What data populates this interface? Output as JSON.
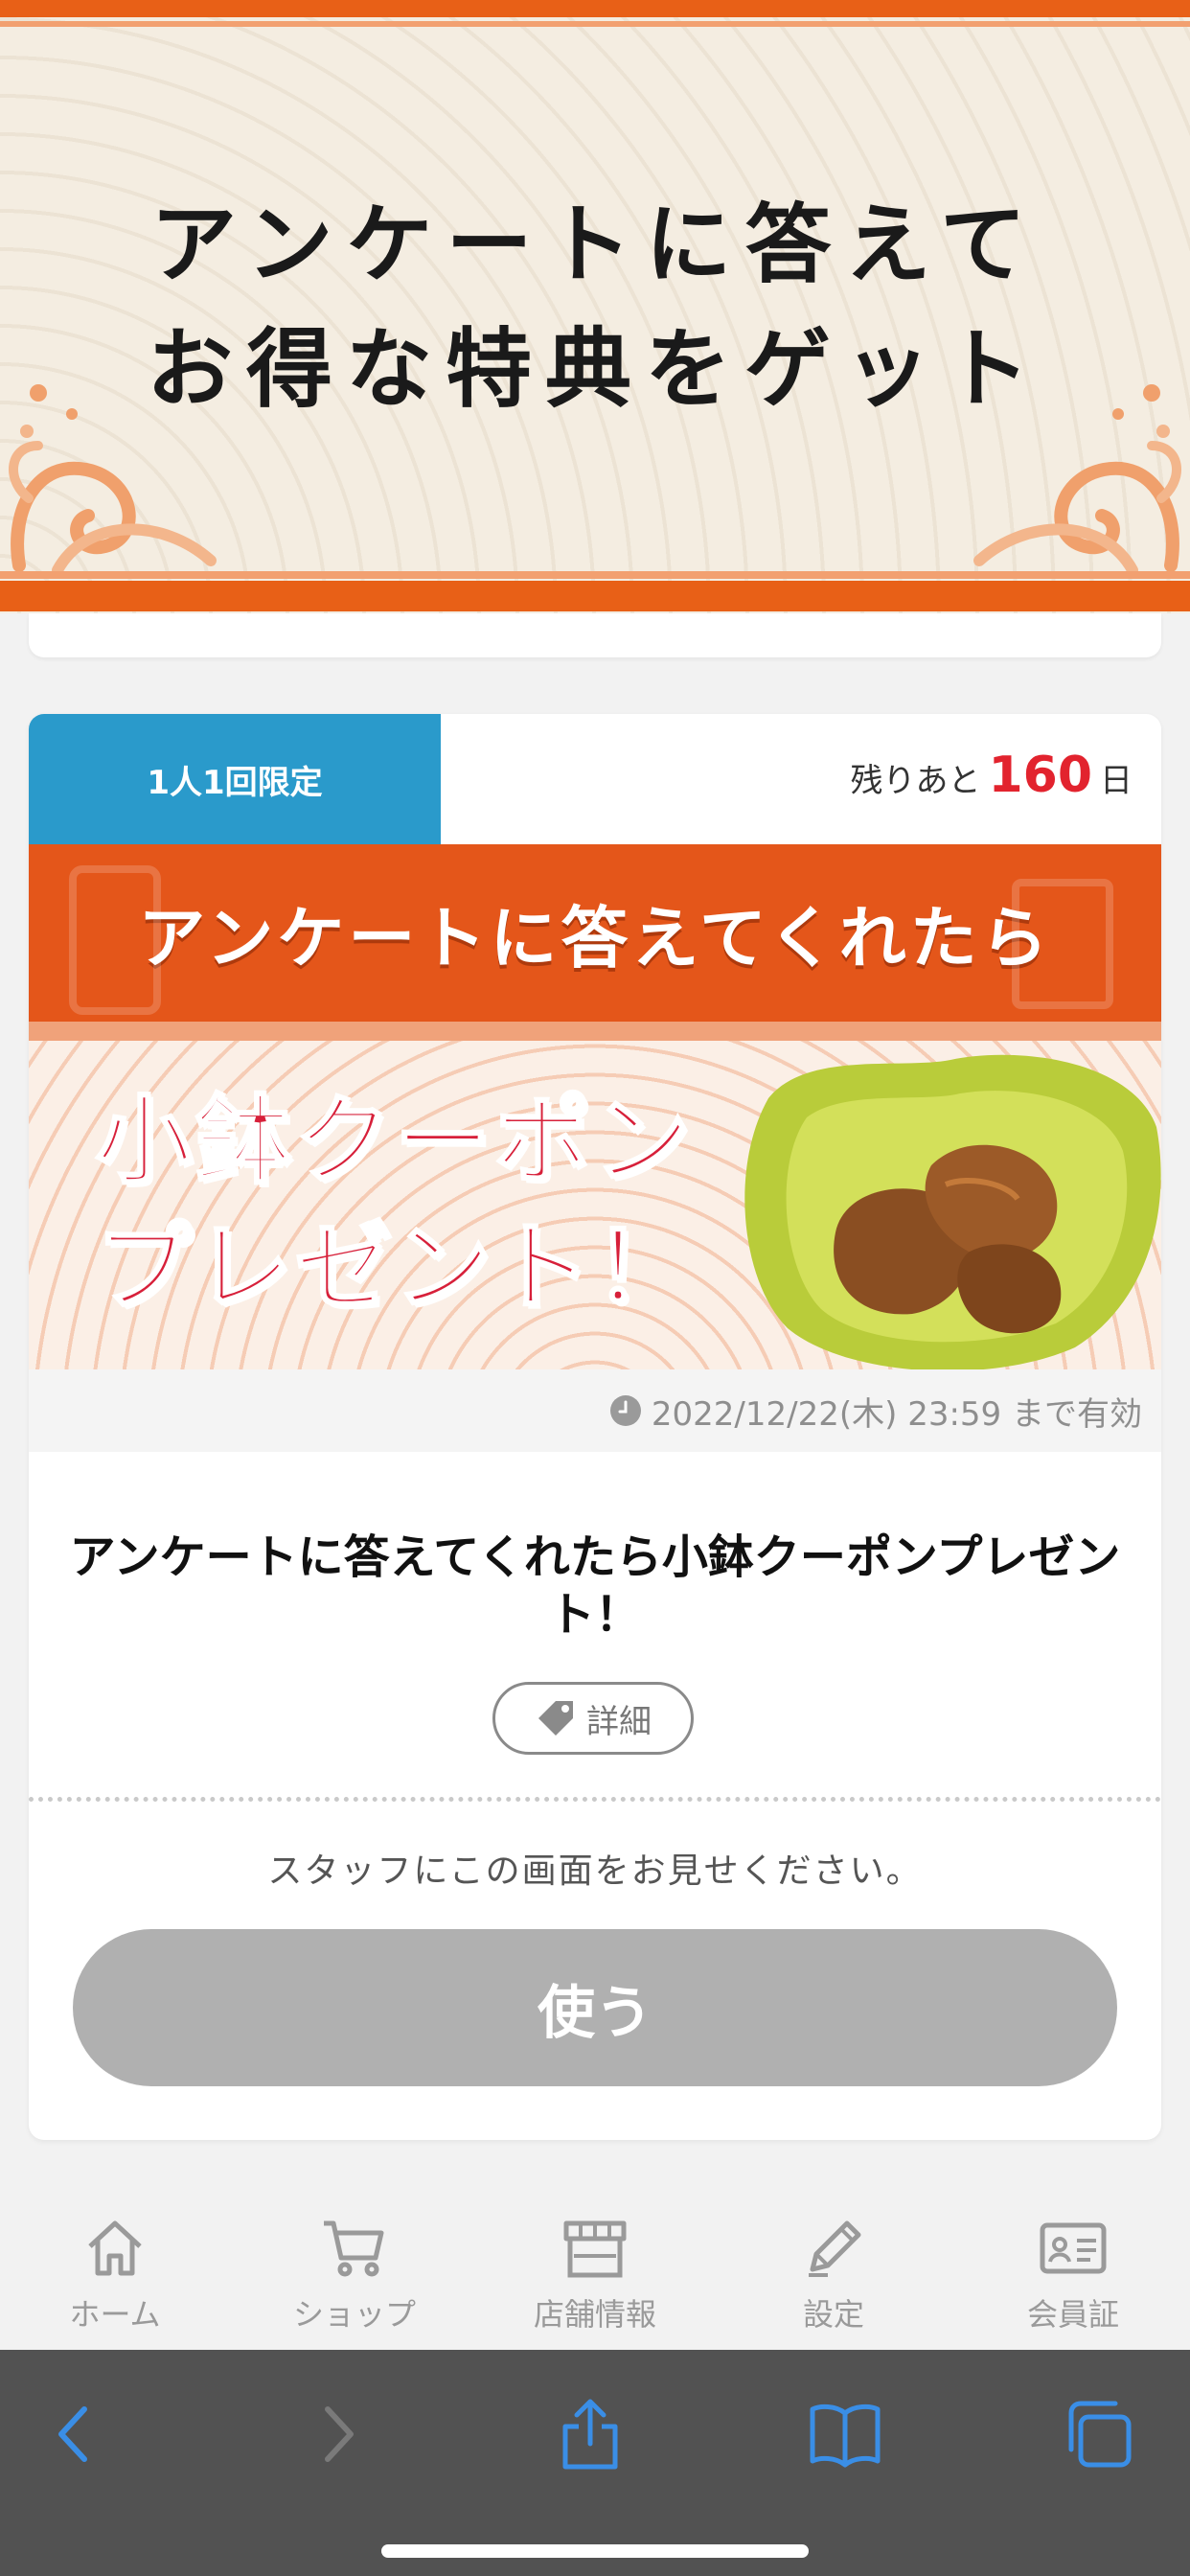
{
  "banner": {
    "title_line1": "アンケートに答えて",
    "title_line2": "お得な特典をゲット"
  },
  "coupon": {
    "limit_badge": "1人1回限定",
    "remaining_prefix": "残りあと",
    "remaining_days": "160",
    "remaining_suffix": "日",
    "image_top_text": "アンケートに答えてくれたら",
    "image_main_line1": "小鉢クーポン",
    "image_main_line2": "プレゼント！",
    "validity": "2022/12/22(木) 23:59 まで有効",
    "title": "アンケートに答えてくれたら小鉢クーポンプレゼント！",
    "detail_label": "詳細",
    "staff_note": "スタッフにこの画面をお見せください。",
    "use_label": "使う",
    "colors": {
      "badge": "#2a9acb",
      "days": "#e2232e",
      "use_button": "#b0b0b0",
      "banner_orange": "#e86017"
    }
  },
  "tabbar": {
    "items": [
      {
        "label": "ホーム",
        "icon": "home-icon"
      },
      {
        "label": "ショップ",
        "icon": "cart-icon"
      },
      {
        "label": "店舗情報",
        "icon": "store-icon"
      },
      {
        "label": "設定",
        "icon": "pencil-icon"
      },
      {
        "label": "会員証",
        "icon": "member-card-icon"
      }
    ]
  },
  "browser_toolbar": {
    "icons": [
      "back-icon",
      "forward-icon",
      "share-icon",
      "bookmarks-icon",
      "tabs-icon"
    ],
    "accent": "#3a8ee6"
  }
}
